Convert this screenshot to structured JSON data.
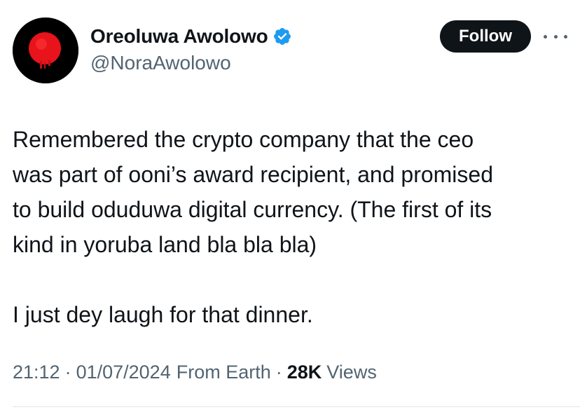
{
  "author": {
    "display_name": "Oreoluwa Awolowo",
    "handle": "@NoraAwolowo",
    "verified": true,
    "avatar_icon": "red-circle-avatar"
  },
  "actions": {
    "follow_label": "Follow",
    "more_icon": "more-dots-icon"
  },
  "tweet": {
    "paragraphs": [
      "Remembered the crypto company that the ceo\nwas part of ooni’s award recipient, and promised\nto build oduduwa digital currency. (The first of its\nkind in yoruba land bla bla bla)",
      "I just dey laugh for that dinner."
    ]
  },
  "meta": {
    "time": "21:12",
    "date": "01/07/2024",
    "source": "From Earth",
    "separator": "·",
    "views_count": "28K",
    "views_label": "Views"
  },
  "colors": {
    "text_primary": "#0f1419",
    "text_secondary": "#536471",
    "verified_blue": "#1d9bf0",
    "follow_bg": "#0f1419",
    "avatar_red": "#e8131b"
  }
}
